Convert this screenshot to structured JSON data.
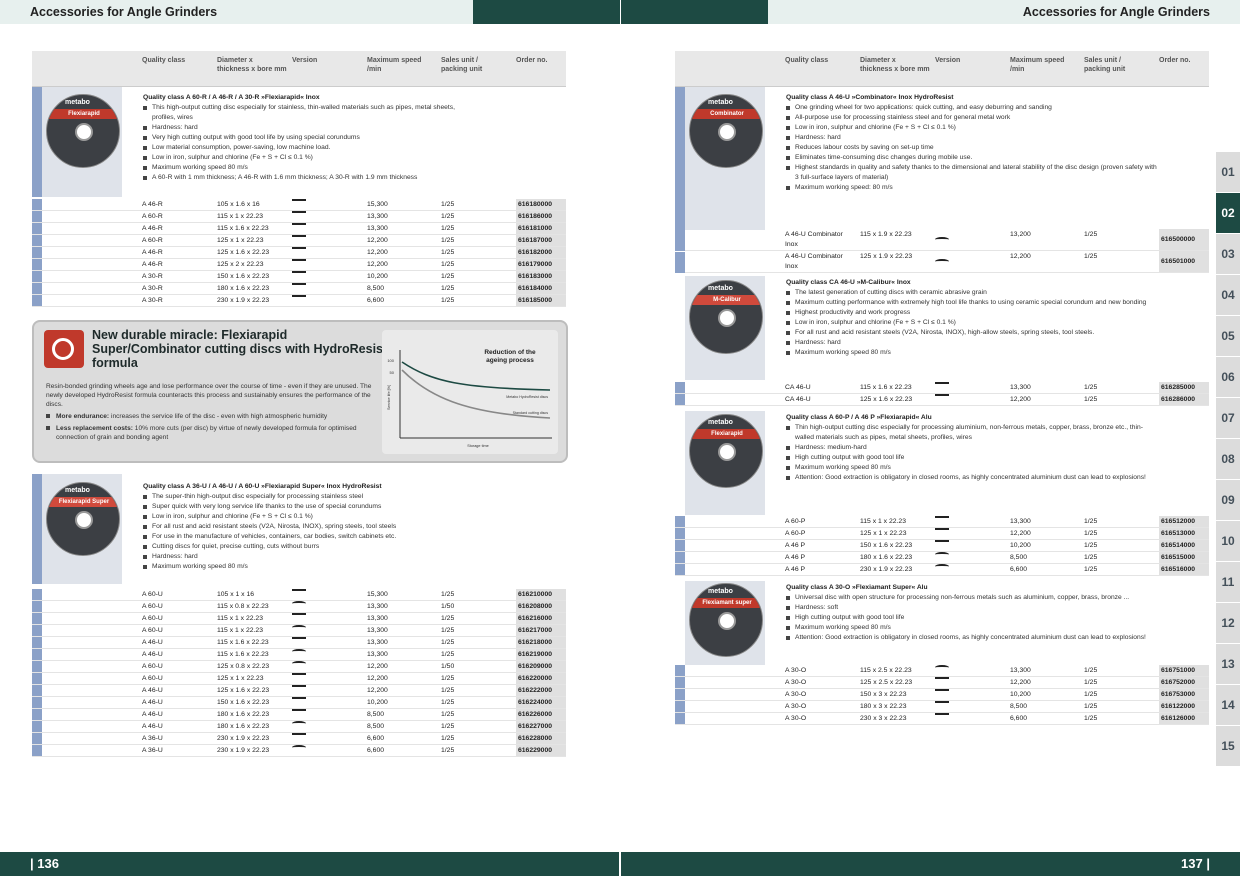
{
  "header": {
    "left_title": "Accessories for Angle Grinders",
    "right_title": "Accessories for Angle Grinders"
  },
  "footer": {
    "left_page": "| 136",
    "right_page": "137 |"
  },
  "table_header": {
    "quality": "Quality class",
    "diameter": "Diameter x thickness x bore mm",
    "version": "Version",
    "speed": "Maximum speed /min",
    "sales": "Sales unit / packing unit",
    "order": "Order no."
  },
  "disc_labels": {
    "brand": "metabo",
    "flexiarapid": "Flexiarapid",
    "flexiarapid_super": "Flexiarapid Super",
    "combinator": "Combinator",
    "mcalibur": "M-Calibur",
    "flexiamant": "Flexiamant super"
  },
  "left": {
    "s1": {
      "title": "Quality class A 60-R / A 46-R / A 30-R »Flexiarapid« Inox",
      "bullets": [
        "This high-output cutting disc especially for stainless, thin-walled materials such as pipes, metal sheets, profiles, wires",
        "Hardness: hard",
        "Very high cutting output with good tool life by using special corundums",
        "Low material consumption, power-saving, low machine load.",
        "Low in iron, sulphur and chlorine (Fe + S + Cl ≤ 0.1 %)",
        "Maximum working speed 80 m/s",
        "A 60-R with 1 mm thickness; A 46-R with 1.6 mm thickness; A 30-R with 1.9 mm thickness"
      ],
      "rows": [
        [
          "A 46-R",
          "105 x 1.6 x 16",
          "line",
          "15,300",
          "1/25",
          "616180000"
        ],
        [
          "A 60-R",
          "115 x 1 x 22.23",
          "line",
          "13,300",
          "1/25",
          "616186000"
        ],
        [
          "A 46-R",
          "115 x 1.6 x 22.23",
          "line",
          "13,300",
          "1/25",
          "616181000"
        ],
        [
          "A 60-R",
          "125 x 1 x 22.23",
          "line",
          "12,200",
          "1/25",
          "616187000"
        ],
        [
          "A 46-R",
          "125 x 1.6 x 22.23",
          "line",
          "12,200",
          "1/25",
          "616182000"
        ],
        [
          "A 46-R",
          "125 x 2 x 22.23",
          "line",
          "12,200",
          "1/25",
          "616179000"
        ],
        [
          "A 30-R",
          "150 x 1.6 x 22.23",
          "line",
          "10,200",
          "1/25",
          "616183000"
        ],
        [
          "A 30-R",
          "180 x 1.6 x 22.23",
          "line",
          "8,500",
          "1/25",
          "616184000"
        ],
        [
          "A 30-R",
          "230 x 1.9 x 22.23",
          "line",
          "6,600",
          "1/25",
          "616185000"
        ]
      ]
    },
    "promo": {
      "title": "New durable miracle: Flexiarapid Super/Combinator cutting discs with HydroResist formula",
      "text": "Resin-bonded grinding wheels age and lose performance over the course of time - even if they are unused. The newly developed HydroResist formula counteracts this process and sustainably ensures the performance of the discs.",
      "b1_bold": "More endurance:",
      "b1": " increases the service life of the disc - even with high atmospheric humidity",
      "b2_bold": "Less replacement costs:",
      "b2": " 10% more cuts (per disc) by virtue of newly developed formula for optimised connection of grain and bonding agent",
      "graph_title": "Reduction of the ageing process",
      "graph_ylabel": "Service life [%]",
      "graph_xlabel": "Storage time",
      "graph_line1": "Metabo HydroResist discs",
      "graph_line2": "Standard cutting discs",
      "graph_y1": "100",
      "graph_y2": "50"
    },
    "s2": {
      "title": "Quality class A 36-U / A 46-U / A 60-U »Flexiarapid Super« Inox HydroResist",
      "bullets": [
        "The super-thin high-output disc especially for processing stainless steel",
        "Super quick with very long service life thanks to the use of special corundums",
        "Low in iron, sulphur and chlorine (Fe + S + Cl ≤ 0.1 %)",
        "For all rust and acid resistant steels (V2A, Nirosta, INOX), spring steels, tool steels",
        "For use in the manufacture of vehicles, containers, car bodies, switch cabinets etc.",
        "Cutting discs for quiet, precise cutting, cuts without burrs",
        "Hardness: hard",
        "Maximum working speed 80 m/s"
      ],
      "rows": [
        [
          "A 60-U",
          "105 x 1 x 16",
          "line",
          "15,300",
          "1/25",
          "616210000"
        ],
        [
          "A 60-U",
          "115 x 0.8 x 22.23",
          "curve",
          "13,300",
          "1/50",
          "616208000"
        ],
        [
          "A 60-U",
          "115 x 1 x 22.23",
          "line",
          "13,300",
          "1/25",
          "616216000"
        ],
        [
          "A 60-U",
          "115 x 1 x 22.23",
          "curve",
          "13,300",
          "1/25",
          "616217000"
        ],
        [
          "A 46-U",
          "115 x 1.6 x 22.23",
          "line",
          "13,300",
          "1/25",
          "616218000"
        ],
        [
          "A 46-U",
          "115 x 1.6 x 22.23",
          "curve",
          "13,300",
          "1/25",
          "616219000"
        ],
        [
          "A 60-U",
          "125 x 0.8 x 22.23",
          "curve",
          "12,200",
          "1/50",
          "616209000"
        ],
        [
          "A 60-U",
          "125 x 1 x 22.23",
          "line",
          "12,200",
          "1/25",
          "616220000"
        ],
        [
          "A 46-U",
          "125 x 1.6 x 22.23",
          "line",
          "12,200",
          "1/25",
          "616222000"
        ],
        [
          "A 46-U",
          "150 x 1.6 x 22.23",
          "line",
          "10,200",
          "1/25",
          "616224000"
        ],
        [
          "A 46-U",
          "180 x 1.6 x 22.23",
          "line",
          "8,500",
          "1/25",
          "616226000"
        ],
        [
          "A 46-U",
          "180 x 1.6 x 22.23",
          "curve",
          "8,500",
          "1/25",
          "616227000"
        ],
        [
          "A 36-U",
          "230 x 1.9 x 22.23",
          "line",
          "6,600",
          "1/25",
          "616228000"
        ],
        [
          "A 36-U",
          "230 x 1.9 x 22.23",
          "curve",
          "6,600",
          "1/25",
          "616229000"
        ]
      ]
    }
  },
  "right": {
    "s1": {
      "title": "Quality class A 46-U »Combinator« Inox HydroResist",
      "bullets": [
        "One grinding wheel for two applications: quick cutting, and easy deburring and sanding",
        "All-purpose use for processing stainless steel and for general metal work",
        "Low in iron, sulphur and chlorine (Fe + S + Cl ≤ 0.1 %)",
        "Hardness: hard",
        "Reduces labour costs by saving on set-up time",
        "Eliminates time-consuming disc changes during mobile use.",
        "Highest standards in quality and safety thanks to the dimensional and lateral stability of the disc design (proven safety with 3 full-surface layers of material)",
        "Maximum working speed: 80 m/s"
      ],
      "rows": [
        [
          "A 46-U Combinator Inox",
          "115 x 1.9 x 22.23",
          "curve",
          "13,200",
          "1/25",
          "616500000"
        ],
        [
          "A 46-U Combinator Inox",
          "125 x 1.9 x 22.23",
          "curve",
          "12,200",
          "1/25",
          "616501000"
        ]
      ]
    },
    "s2": {
      "title": "Quality class CA 46-U »M-Calibur« Inox",
      "bullets": [
        "The latest generation of cutting discs with ceramic abrasive grain",
        "Maximum cutting performance with extremely high tool life thanks to using ceramic special corundum and new bonding",
        "Highest productivity and work progress",
        "Low in iron, sulphur and chlorine (Fe + S + Cl ≤ 0.1 %)",
        "For all rust and acid resistant steels (V2A, Nirosta, INOX), high-allow steels, spring steels, tool steels.",
        "Hardness: hard",
        "Maximum working speed 80 m/s"
      ],
      "rows": [
        [
          "CA 46-U",
          "115 x 1.6 x 22.23",
          "line",
          "13,300",
          "1/25",
          "616285000"
        ],
        [
          "CA 46-U",
          "125 x 1.6 x 22.23",
          "line",
          "12,200",
          "1/25",
          "616286000"
        ]
      ]
    },
    "s3": {
      "title": "Quality class A 60-P / A 46 P »Flexiarapid« Alu",
      "bullets": [
        "Thin high-output cutting disc especially for processing aluminium, non-ferrous metals, copper, brass, bronze etc., thin-walled materials such as pipes, metal sheets, profiles, wires",
        "Hardness: medium-hard",
        "High cutting output with good tool life",
        "Maximum working speed 80 m/s",
        "Attention: Good extraction is obligatory in closed rooms, as highly concentrated aluminium dust can lead to explosions!"
      ],
      "rows": [
        [
          "A 60-P",
          "115 x 1 x 22.23",
          "line",
          "13,300",
          "1/25",
          "616512000"
        ],
        [
          "A 60-P",
          "125 x 1 x 22.23",
          "line",
          "12,200",
          "1/25",
          "616513000"
        ],
        [
          "A 46 P",
          "150 x 1.6 x 22.23",
          "line",
          "10,200",
          "1/25",
          "616514000"
        ],
        [
          "A 46 P",
          "180 x 1.6 x 22.23",
          "curve",
          "8,500",
          "1/25",
          "616515000"
        ],
        [
          "A 46 P",
          "230 x 1.9 x 22.23",
          "curve",
          "6,600",
          "1/25",
          "616516000"
        ]
      ]
    },
    "s4": {
      "title": "Quality class A 30-O »Flexiamant Super« Alu",
      "bullets": [
        "Universal disc with open structure for processing non-ferrous metals such as aluminium, copper, brass, bronze ...",
        "Hardness: soft",
        "High cutting output with good tool life",
        "Maximum working speed 80 m/s",
        "Attention: Good extraction is obligatory in closed rooms, as highly concentrated aluminium dust can lead to explosions!"
      ],
      "rows": [
        [
          "A 30-O",
          "115 x 2.5 x 22.23",
          "curve",
          "13,300",
          "1/25",
          "616751000"
        ],
        [
          "A 30-O",
          "125 x 2.5 x 22.23",
          "line",
          "12,200",
          "1/25",
          "616752000"
        ],
        [
          "A 30-O",
          "150 x 3 x 22.23",
          "line",
          "10,200",
          "1/25",
          "616753000"
        ],
        [
          "A 30-O",
          "180 x 3 x 22.23",
          "line",
          "8,500",
          "1/25",
          "616122000"
        ],
        [
          "A 30-O",
          "230 x 3 x 22.23",
          "line",
          "6,600",
          "1/25",
          "616126000"
        ]
      ]
    }
  },
  "tabs": [
    "01",
    "02",
    "03",
    "04",
    "05",
    "06",
    "07",
    "08",
    "09",
    "10",
    "11",
    "12",
    "13",
    "14",
    "15"
  ],
  "active_tab": "02"
}
